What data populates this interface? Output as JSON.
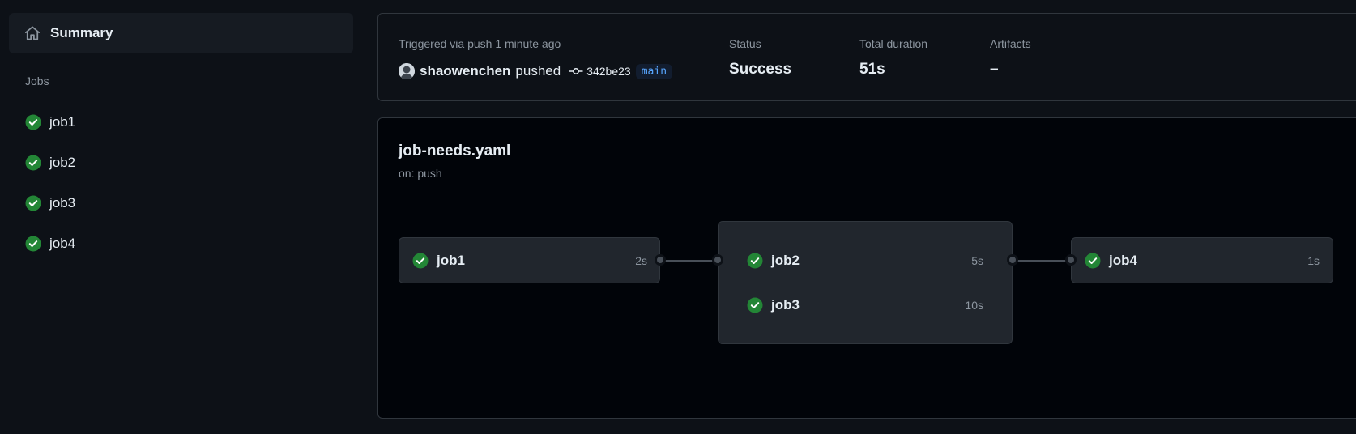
{
  "sidebar": {
    "summary_label": "Summary",
    "jobs_heading": "Jobs",
    "jobs": [
      {
        "label": "job1",
        "status": "success"
      },
      {
        "label": "job2",
        "status": "success"
      },
      {
        "label": "job3",
        "status": "success"
      },
      {
        "label": "job4",
        "status": "success"
      }
    ]
  },
  "run_summary": {
    "trigger_text": "Triggered via push 1 minute ago",
    "actor": "shaowenchen",
    "event": "pushed",
    "commit_sha": "342be23",
    "branch": "main",
    "status_label": "Status",
    "status_value": "Success",
    "duration_label": "Total duration",
    "duration_value": "51s",
    "artifacts_label": "Artifacts",
    "artifacts_value": "–"
  },
  "workflow": {
    "name": "job-needs.yaml",
    "trigger": "on: push",
    "stages": [
      {
        "jobs": [
          {
            "name": "job1",
            "duration": "2s",
            "status": "success"
          }
        ]
      },
      {
        "jobs": [
          {
            "name": "job2",
            "duration": "5s",
            "status": "success"
          },
          {
            "name": "job3",
            "duration": "10s",
            "status": "success"
          }
        ]
      },
      {
        "jobs": [
          {
            "name": "job4",
            "duration": "1s",
            "status": "success"
          }
        ]
      }
    ]
  },
  "colors": {
    "background": "#0d1117",
    "success": "#238636",
    "link": "#58a6ff",
    "muted_text": "#8d96a0"
  }
}
